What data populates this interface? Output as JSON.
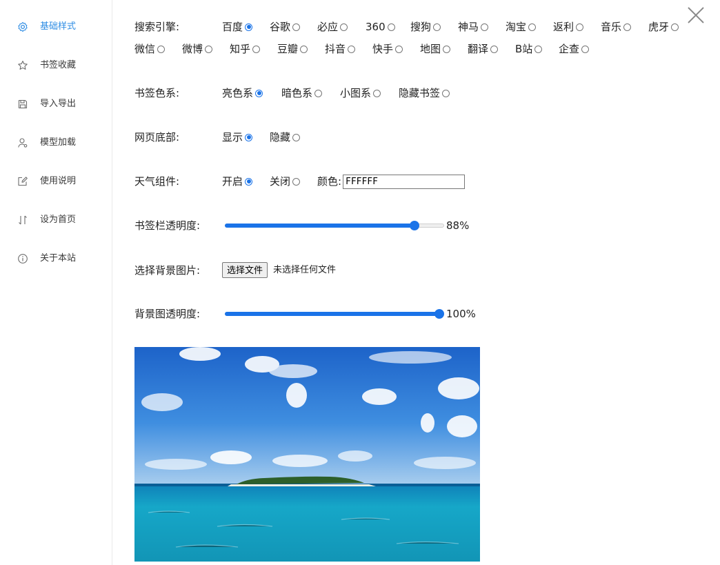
{
  "sidebar": {
    "items": [
      {
        "label": "基础样式",
        "icon": "gear-icon",
        "active": true
      },
      {
        "label": "书签收藏",
        "icon": "star-icon",
        "active": false
      },
      {
        "label": "导入导出",
        "icon": "save-icon",
        "active": false
      },
      {
        "label": "模型加载",
        "icon": "user-model-icon",
        "active": false
      },
      {
        "label": "使用说明",
        "icon": "edit-icon",
        "active": false
      },
      {
        "label": "设为首页",
        "icon": "sort-arrows-icon",
        "active": false
      },
      {
        "label": "关于本站",
        "icon": "info-icon",
        "active": false
      }
    ],
    "active_color": "#2f8de4"
  },
  "close": {
    "icon": "close-icon"
  },
  "settings": {
    "search_engine": {
      "label": "搜索引擎:",
      "selected": "百度",
      "options": [
        "百度",
        "谷歌",
        "必应",
        "360",
        "搜狗",
        "神马",
        "淘宝",
        "返利",
        "音乐",
        "虎牙",
        "微信",
        "微博",
        "知乎",
        "豆瓣",
        "抖音",
        "快手",
        "地图",
        "翻译",
        "B站",
        "企查"
      ]
    },
    "bookmark_color": {
      "label": "书签色系:",
      "selected": "亮色系",
      "options": [
        "亮色系",
        "暗色系",
        "小图系",
        "隐藏书签"
      ]
    },
    "footer": {
      "label": "网页底部:",
      "selected": "显示",
      "options": [
        "显示",
        "隐藏"
      ]
    },
    "weather": {
      "label": "天气组件:",
      "selected": "开启",
      "options": [
        "开启",
        "关闭"
      ],
      "color_label": "颜色:",
      "color_value": "FFFFFF"
    },
    "bookmark_opacity": {
      "label": "书签栏透明度:",
      "value": 0.88,
      "value_text": "88%"
    },
    "background_image": {
      "label": "选择背景图片:",
      "button": "选择文件",
      "status": "未选择任何文件"
    },
    "background_opacity": {
      "label": "背景图透明度:",
      "value": 1.0,
      "value_text": "100%"
    }
  },
  "accent_color": "#1a73e8"
}
